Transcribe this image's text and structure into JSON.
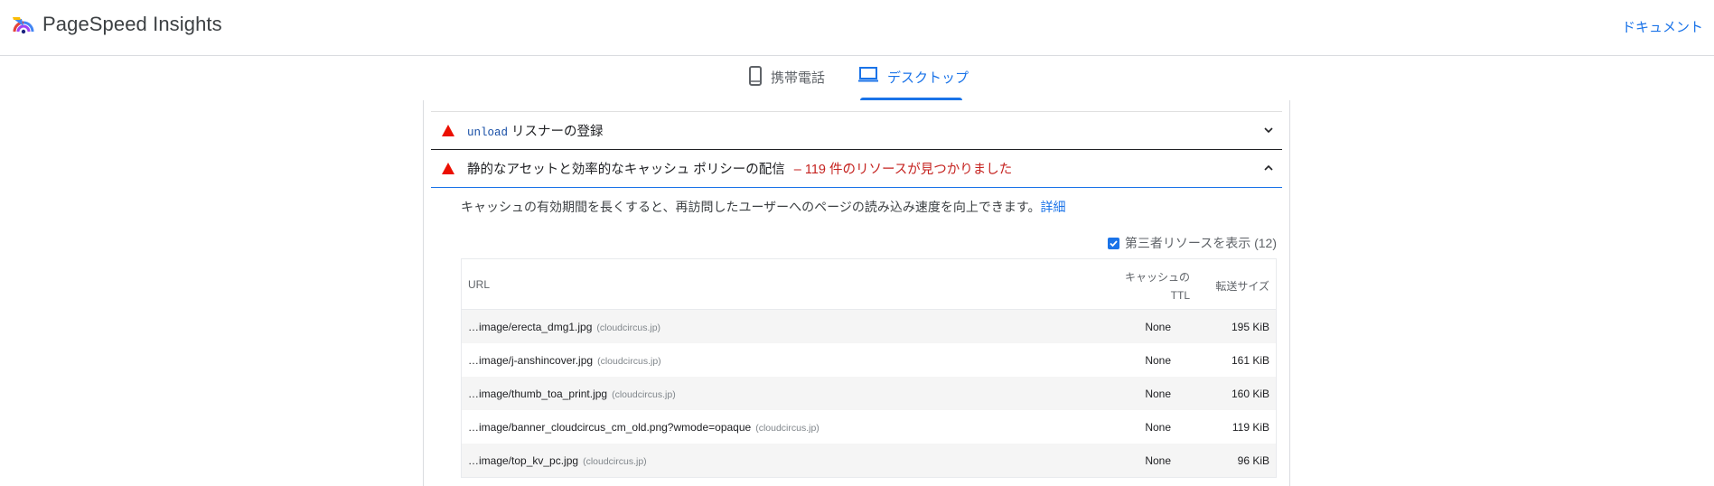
{
  "app": {
    "title": "PageSpeed Insights",
    "docs_link": "ドキュメント"
  },
  "tabs": [
    {
      "label": "携帯電話",
      "icon": "phone-icon",
      "selected": false
    },
    {
      "label": "デスクトップ",
      "icon": "laptop-icon",
      "selected": true
    }
  ],
  "audits": [
    {
      "code": "unload",
      "title": " リスナーの登録",
      "status": "fail",
      "expanded": false
    },
    {
      "title": "静的なアセットと効率的なキャッシュ ポリシーの配信",
      "display_value": "– 119 件のリソースが見つかりました",
      "status": "fail",
      "expanded": true
    }
  ],
  "details": {
    "description": "キャッシュの有効期間を長くすると、再訪問したユーザーへのページの読み込み速度を向上できます。",
    "learn_more": "詳細",
    "third_party_label": "第三者リソースを表示 (12)",
    "third_party_checked": true
  },
  "table": {
    "headers": {
      "url": "URL",
      "ttl_line1": "キャッシュの",
      "ttl_line2": "TTL",
      "size": "転送サイズ"
    },
    "rows": [
      {
        "url": "…image/erecta_dmg1.jpg",
        "host": "(cloudcircus.jp)",
        "ttl": "None",
        "size": "195 KiB"
      },
      {
        "url": "…image/j-anshincover.jpg",
        "host": "(cloudcircus.jp)",
        "ttl": "None",
        "size": "161 KiB"
      },
      {
        "url": "…image/thumb_toa_print.jpg",
        "host": "(cloudcircus.jp)",
        "ttl": "None",
        "size": "160 KiB"
      },
      {
        "url": "…image/banner_cloudcircus_cm_old.png?wmode=opaque",
        "host": "(cloudcircus.jp)",
        "ttl": "None",
        "size": "119 KiB"
      },
      {
        "url": "…image/top_kv_pc.jpg",
        "host": "(cloudcircus.jp)",
        "ttl": "None",
        "size": "96 KiB"
      }
    ]
  },
  "colors": {
    "accent": "#1a73e8",
    "fail": "#eb0f00",
    "fail_text": "#c5221f"
  }
}
